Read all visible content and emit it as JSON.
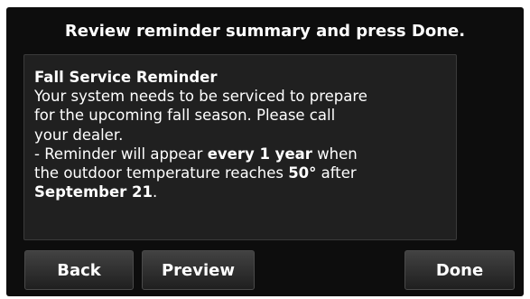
{
  "header": {
    "instruction": "Review reminder summary and press Done."
  },
  "reminder": {
    "title": "Fall Service Reminder",
    "line1": "Your system needs to be serviced to prepare",
    "line2": "for the upcoming fall season. Please call",
    "line3": "your dealer.",
    "line4_pre": "- Reminder will appear ",
    "frequency": "every 1 year",
    "line4_post": " when",
    "line5_pre": "the outdoor temperature reaches ",
    "temperature": "50°",
    "line5_post": " after",
    "date": "September 21",
    "date_suffix": "."
  },
  "buttons": {
    "back_label": "Back",
    "preview_label": "Preview",
    "done_label": "Done"
  },
  "colors": {
    "screen_background": "#0d0d0d",
    "panel_background": "#202020",
    "text": "#ffffff"
  }
}
